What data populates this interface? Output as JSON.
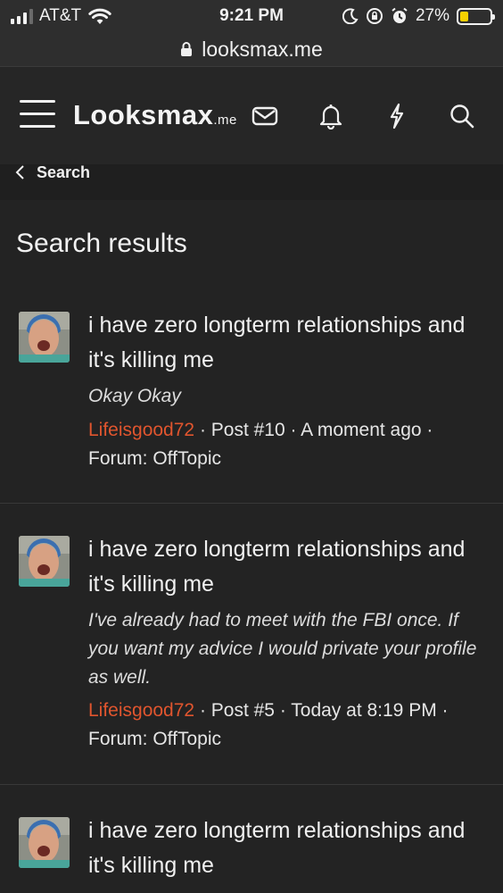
{
  "status_bar": {
    "carrier": "AT&T",
    "time": "9:21 PM",
    "battery_percent": "27%",
    "battery_level": 0.27,
    "battery_color": "#f5d000",
    "signal_bars_active": 3,
    "icons": [
      "signal-icon",
      "wifi-icon",
      "moon-icon",
      "orientation-lock-icon",
      "alarm-icon",
      "battery-icon"
    ]
  },
  "browser": {
    "url": "looksmax.me",
    "lock_icon": "lock-icon"
  },
  "header": {
    "logo_main": "Looksmax",
    "logo_tld": ".me",
    "icons": [
      "menu-icon",
      "mail-icon",
      "bell-icon",
      "bolt-icon",
      "search-icon"
    ]
  },
  "breadcrumb": {
    "back_label": "Search"
  },
  "page": {
    "title": "Search results"
  },
  "results": [
    {
      "title": "i have zero longterm relationships and it's killing me",
      "snippet": "Okay Okay",
      "user": "Lifeisgood72",
      "meta_rest": " · Post #10 · A moment ago ·",
      "forum": "Forum: OffTopic"
    },
    {
      "title": "i have zero longterm relationships and it's killing me",
      "snippet": "I've already had to meet with the FBI once. If you want my advice I would private your profile as well.",
      "user": "Lifeisgood72",
      "meta_rest": " · Post #5 · Today at 8:19 PM ·",
      "forum": "Forum: OffTopic"
    },
    {
      "title": "i have zero longterm relationships and it's killing me"
    }
  ],
  "colors": {
    "background": "#232323",
    "header": "#262626",
    "username": "#e0552e"
  }
}
